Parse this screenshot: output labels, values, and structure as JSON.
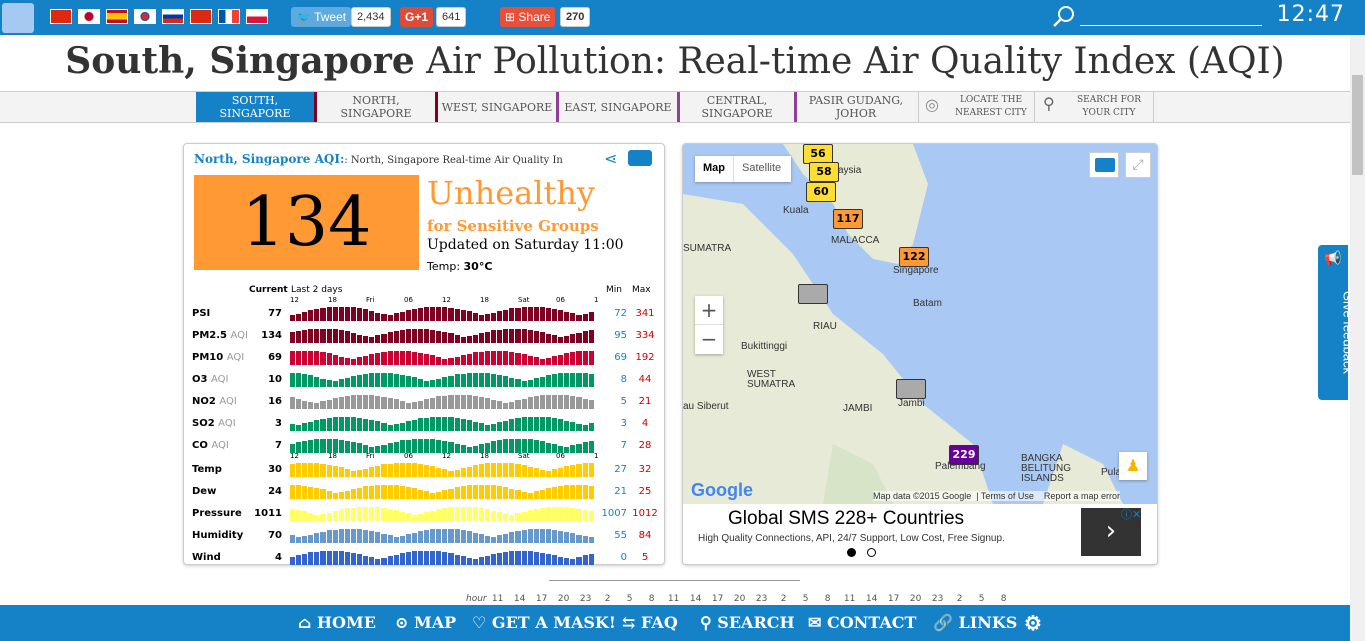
{
  "header": {
    "tweet": "Tweet",
    "tweet_count": "2,434",
    "gplus": "G+1",
    "gplus_count": "641",
    "share": "Share",
    "share_count": "270",
    "clock": "12:47"
  },
  "title": {
    "bold": "South, Singapore",
    "rest": " Air Pollution: Real-time Air Quality Index (AQI)"
  },
  "nav": [
    {
      "label": "SOUTH, SINGAPORE"
    },
    {
      "label": "NORTH, SINGAPORE"
    },
    {
      "label": "WEST, SINGAPORE"
    },
    {
      "label": "EAST, SINGAPORE"
    },
    {
      "label": "CENTRAL,\nSINGAPORE"
    },
    {
      "label": "PASIR GUDANG,\nJOHOR"
    },
    {
      "label": "LOCATE THE\nNEAREST CITY"
    },
    {
      "label": "SEARCH FOR\nYOUR CITY"
    }
  ],
  "widget": {
    "station": "North, Singapore AQI:",
    "subtitle": ": North, Singapore Real-time Air Quality In",
    "aqi": "134",
    "level": "Unhealthy",
    "level_sub": "for Sensitive Groups",
    "updated": "Updated on Saturday 11:00",
    "temp_label": "Temp:",
    "temp_value": "30°C",
    "col_current": "Current",
    "col_last": "Last 2 days",
    "col_min": "Min",
    "col_max": "Max",
    "ticks1": [
      "12",
      "18",
      "Fri",
      "06",
      "12",
      "18",
      "Sat",
      "06",
      "1"
    ],
    "ticks2": [
      "12",
      "18",
      "Fri",
      "06",
      "12",
      "18",
      "Sat",
      "06",
      "1"
    ]
  },
  "pollutants": [
    {
      "name": "PSI",
      "unit": "",
      "current": "77",
      "min": "72",
      "max": "341",
      "color": "#7e0023"
    },
    {
      "name": "PM2.5",
      "unit": "AQI",
      "current": "134",
      "min": "95",
      "max": "334",
      "color": "#7e0023"
    },
    {
      "name": "PM10",
      "unit": "AQI",
      "current": "69",
      "min": "69",
      "max": "192",
      "color": "#cc0033"
    },
    {
      "name": "O3",
      "unit": "AQI",
      "current": "10",
      "min": "8",
      "max": "44",
      "color": "#009966"
    },
    {
      "name": "NO2",
      "unit": "AQI",
      "current": "16",
      "min": "5",
      "max": "21",
      "color": "#999999"
    },
    {
      "name": "SO2",
      "unit": "AQI",
      "current": "3",
      "min": "3",
      "max": "4",
      "color": "#009966"
    },
    {
      "name": "CO",
      "unit": "AQI",
      "current": "7",
      "min": "7",
      "max": "28",
      "color": "#009966"
    },
    {
      "name": "Temp",
      "unit": "",
      "current": "30",
      "min": "27",
      "max": "32",
      "color": "#ffcc00"
    },
    {
      "name": "Dew",
      "unit": "",
      "current": "24",
      "min": "21",
      "max": "25",
      "color": "#ffcc00"
    },
    {
      "name": "Pressure",
      "unit": "",
      "current": "1011",
      "min": "1007",
      "max": "1012",
      "color": "#ffff66"
    },
    {
      "name": "Humidity",
      "unit": "",
      "current": "70",
      "min": "55",
      "max": "84",
      "color": "#6699cc"
    },
    {
      "name": "Wind",
      "unit": "",
      "current": "4",
      "min": "0",
      "max": "5",
      "color": "#3366cc"
    }
  ],
  "map": {
    "tab_map": "Map",
    "tab_sat": "Satellite",
    "labels": [
      "aysia",
      "Kuala",
      "MALACCA",
      "SUMATRA",
      "Singapore",
      "Batam",
      "RIAU",
      "Bukittinggi",
      "WEST SUMATRA",
      "au Siberut",
      "JAMBI",
      "Jambi",
      "Palembang",
      "BANGKA BELITUNG ISLANDS",
      "Pulau Be"
    ],
    "markers": [
      "56",
      "58",
      "60",
      "117",
      "122",
      "229"
    ],
    "attribution": "Map data ©2015 Google",
    "terms": "Terms of Use",
    "report": "Report a map error",
    "google": "Google"
  },
  "ad": {
    "headline": "Global SMS 228+ Countries",
    "body": "High Quality Connections, API, 24/7 Support, Low Cost, Free Signup."
  },
  "hours": {
    "label": "hour",
    "values": [
      "11",
      "14",
      "17",
      "20",
      "23",
      "2",
      "5",
      "8",
      "11",
      "14",
      "17",
      "20",
      "23",
      "2",
      "5",
      "8",
      "11",
      "14",
      "17",
      "20",
      "23",
      "2",
      "5",
      "8"
    ]
  },
  "feedback": "Give feedback",
  "bottom": [
    {
      "label": "HOME"
    },
    {
      "label": "MAP"
    },
    {
      "label": "GET A MASK!"
    },
    {
      "label": "FAQ"
    },
    {
      "label": "SEARCH"
    },
    {
      "label": "CONTACT"
    },
    {
      "label": "LINKS"
    }
  ]
}
